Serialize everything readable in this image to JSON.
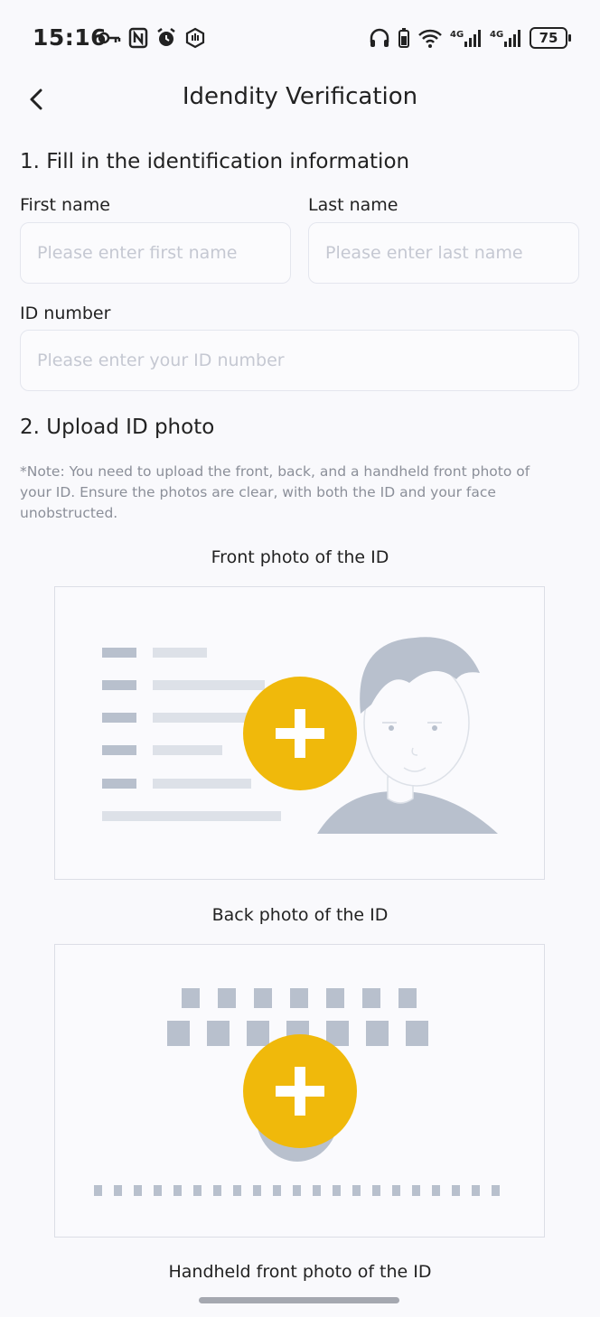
{
  "status_bar": {
    "time": "15:16",
    "battery": "75"
  },
  "header": {
    "title": "Idendity Verification"
  },
  "section1": {
    "title": "1. Fill in the identification information",
    "first_name": {
      "label": "First name",
      "placeholder": "Please enter first name"
    },
    "last_name": {
      "label": "Last name",
      "placeholder": "Please enter last name"
    },
    "id_number": {
      "label": "ID number",
      "placeholder": "Please enter your ID number"
    }
  },
  "section2": {
    "title": "2. Upload ID photo",
    "note": "*Note: You need to upload the front, back, and a handheld front photo of your ID. Ensure the photos are clear, with both the ID and your face unobstructed.",
    "front_label": "Front photo of the ID",
    "back_label": "Back photo of the ID",
    "handheld_label": "Handheld front photo of the ID"
  },
  "colors": {
    "accent": "#f0b90b",
    "illustration": "#b8c0cd",
    "illustration_light": "#dde1e8"
  }
}
